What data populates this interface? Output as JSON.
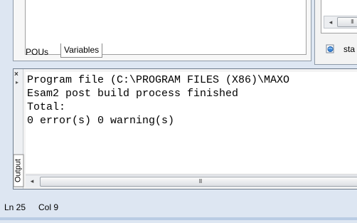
{
  "top_panel": {
    "tabs": [
      {
        "label": "POUs"
      },
      {
        "label": "Variables"
      }
    ],
    "scroll_glyph": "III",
    "right_tab_label": "sta"
  },
  "output": {
    "tab_label": "Output",
    "lines": [
      "Program file (C:\\PROGRAM FILES (X86)\\MAXO",
      "Esam2 post build process finished",
      "Total:",
      "0 error(s) 0 warning(s)"
    ],
    "scroll_glyph": "III"
  },
  "status_bar": {
    "line": "Ln 25",
    "column": "Col 9"
  },
  "colors": {
    "window_bg": "#dde6f2",
    "panel_border": "#6f7d8e",
    "editor_bg": "#ffffff"
  }
}
